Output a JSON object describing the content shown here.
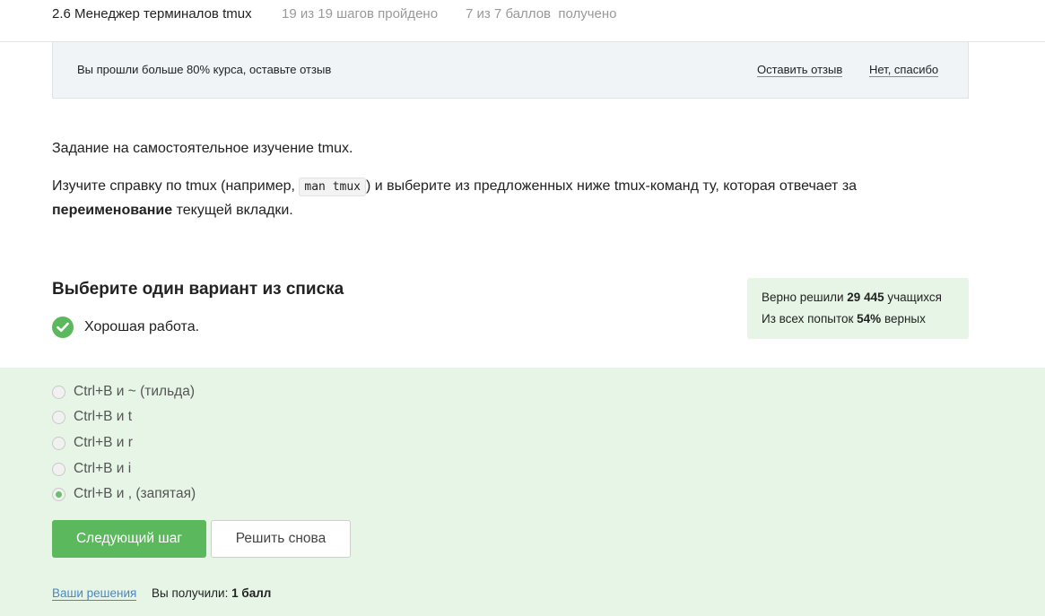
{
  "header": {
    "step_title": "2.6 Менеджер терминалов tmux",
    "progress": "19 из 19 шагов пройдено",
    "score": "7 из 7 баллов  получено"
  },
  "feedback_banner": {
    "message": "Вы прошли больше 80% курса, оставьте отзыв",
    "leave_review": "Оставить отзыв",
    "no_thanks": "Нет, спасибо"
  },
  "task": {
    "paragraph1": "Задание на самостоятельное изучение tmux.",
    "p2_before": "Изучите справку по tmux (например, ",
    "p2_code": "man tmux",
    "p2_after": ") и выберите из предложенных ниже tmux-команд ту, которая отвечает за ",
    "p2_bold": "переименование",
    "p2_end": " текущей вкладки."
  },
  "quiz": {
    "title": "Выберите один вариант из списка",
    "result": "Хорошая работа.",
    "options": [
      {
        "label": "Ctrl+B и ~ (тильда)",
        "selected": false
      },
      {
        "label": "Ctrl+B и t",
        "selected": false
      },
      {
        "label": "Ctrl+B и r",
        "selected": false
      },
      {
        "label": "Ctrl+B и i",
        "selected": false
      },
      {
        "label": "Ctrl+B и , (запятая)",
        "selected": true
      }
    ],
    "next_button": "Следующий шаг",
    "retry_button": "Решить снова",
    "solutions_link": "Ваши решения",
    "got_label": "Вы получили: ",
    "got_value": "1 балл"
  },
  "stats": {
    "solved_prefix": "Верно решили ",
    "solved_count": "29 445",
    "solved_suffix": " учащихся",
    "attempts_prefix": "Из всех попыток ",
    "attempts_percent": "54%",
    "attempts_suffix": " верных"
  },
  "colors": {
    "accent_green": "#5cb85c",
    "answer_bg": "#e6f5e6",
    "link_blue": "#4a86c5"
  }
}
